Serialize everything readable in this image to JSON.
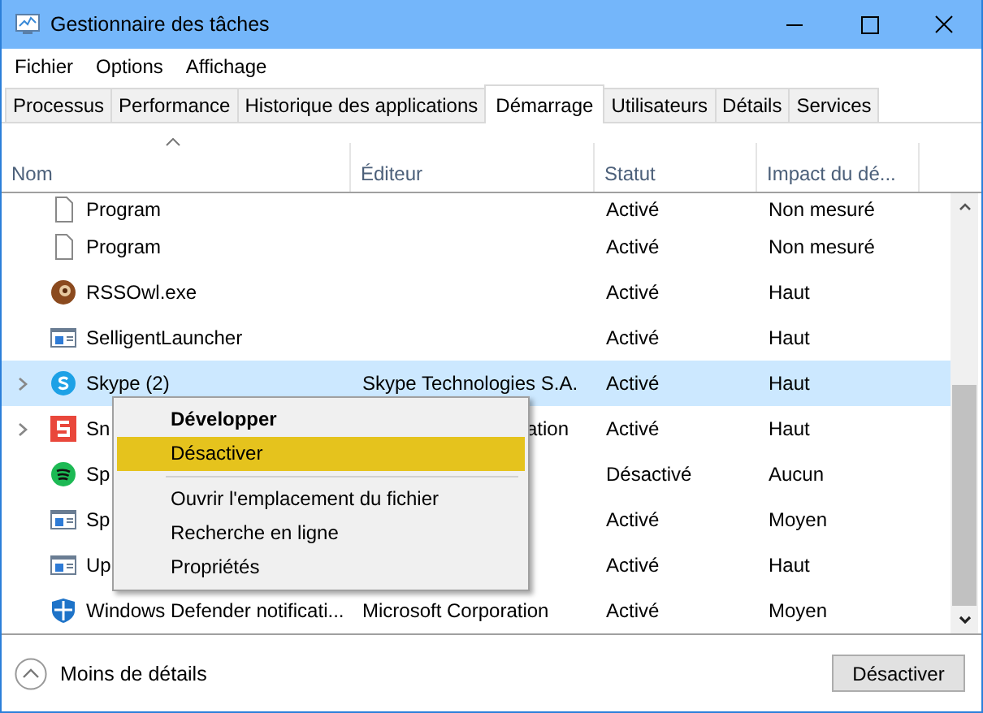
{
  "window": {
    "title": "Gestionnaire des tâches"
  },
  "menu_bar": [
    "Fichier",
    "Options",
    "Affichage"
  ],
  "tabs": [
    {
      "label": "Processus",
      "selected": false
    },
    {
      "label": "Performance",
      "selected": false
    },
    {
      "label": "Historique des applications",
      "selected": false
    },
    {
      "label": "Démarrage",
      "selected": true
    },
    {
      "label": "Utilisateurs",
      "selected": false
    },
    {
      "label": "Détails",
      "selected": false
    },
    {
      "label": "Services",
      "selected": false
    }
  ],
  "table": {
    "columns": [
      "Nom",
      "Éditeur",
      "Statut",
      "Impact du dé..."
    ],
    "rows": [
      {
        "name": "Program",
        "status": "Activé",
        "impact": "Non mesuré",
        "expandable": false,
        "selected": false
      },
      {
        "name": "Program",
        "status": "Activé",
        "impact": "Non mesuré",
        "expandable": false,
        "selected": false
      },
      {
        "name": "RSSOwl.exe",
        "status": "Activé",
        "impact": "Haut",
        "expandable": false,
        "selected": false
      },
      {
        "name": "SelligentLauncher",
        "status": "Activé",
        "impact": "Haut",
        "expandable": false,
        "selected": false
      },
      {
        "name": "Skype (2)",
        "editor": "Skype Technologies S.A.",
        "status": "Activé",
        "impact": "Haut",
        "expandable": true,
        "selected": true
      },
      {
        "name": "Sn",
        "editor_tail": "ation",
        "status": "Activé",
        "impact": "Haut",
        "expandable": true,
        "selected": false
      },
      {
        "name": "Sp",
        "status": "Désactivé",
        "impact": "Aucun",
        "expandable": false,
        "selected": false
      },
      {
        "name": "Sp",
        "status": "Activé",
        "impact": "Moyen",
        "expandable": false,
        "selected": false
      },
      {
        "name": "Up",
        "status": "Activé",
        "impact": "Haut",
        "expandable": false,
        "selected": false
      },
      {
        "name": "Windows Defender notificati...",
        "editor": "Microsoft Corporation",
        "status": "Activé",
        "impact": "Moyen",
        "expandable": false,
        "selected": false
      }
    ]
  },
  "context_menu": [
    {
      "kind": "item",
      "label": "Développer",
      "default": true,
      "selected": false
    },
    {
      "kind": "item",
      "label": "Désactiver",
      "default": false,
      "selected": true
    },
    {
      "kind": "separator"
    },
    {
      "kind": "item",
      "label": "Ouvrir l'emplacement du fichier",
      "default": false,
      "selected": false
    },
    {
      "kind": "item",
      "label": "Recherche en ligne",
      "default": false,
      "selected": false
    },
    {
      "kind": "item",
      "label": "Propriétés",
      "default": false,
      "selected": false
    }
  ],
  "footer": {
    "details_label": "Moins de détails",
    "button": "Désactiver"
  }
}
